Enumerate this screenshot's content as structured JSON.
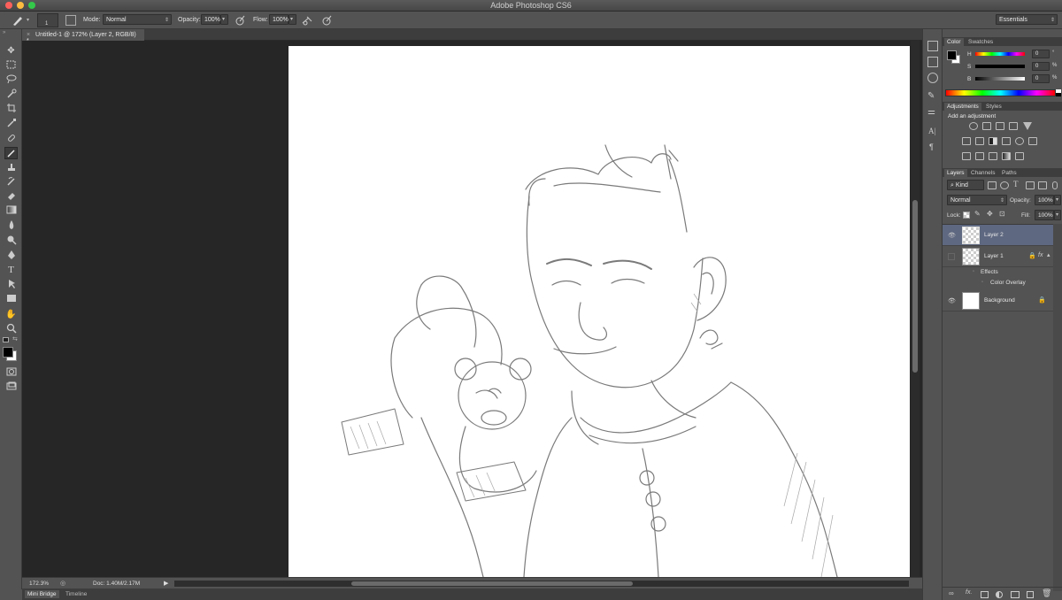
{
  "window": {
    "title": "Adobe Photoshop CS6",
    "traffic": [
      "#fc605c",
      "#fdbc40",
      "#34c84a"
    ]
  },
  "options": {
    "brush_size": "1",
    "mode_label": "Mode:",
    "mode_value": "Normal",
    "opacity_label": "Opacity:",
    "opacity_value": "100%",
    "flow_label": "Flow:",
    "flow_value": "100%",
    "workspace": "Essentials"
  },
  "document": {
    "tab_title": "Untitled-1 @ 172% (Layer 2, RGB/8) *"
  },
  "status": {
    "zoom": "172.3%",
    "doc_info": "Doc: 1.40M/2.17M"
  },
  "bottom_tabs": [
    "Mini Bridge",
    "Timeline"
  ],
  "color_panel": {
    "tabs": [
      "Color",
      "Swatches"
    ],
    "sliders": [
      {
        "label": "H",
        "value": "0",
        "unit": "°"
      },
      {
        "label": "S",
        "value": "0",
        "unit": "%"
      },
      {
        "label": "B",
        "value": "0",
        "unit": "%"
      }
    ]
  },
  "adjustments_panel": {
    "tabs": [
      "Adjustments",
      "Styles"
    ],
    "heading": "Add an adjustment"
  },
  "layers_panel": {
    "tabs": [
      "Layers",
      "Channels",
      "Paths"
    ],
    "filter_kind": "Kind",
    "blend_mode": "Normal",
    "opacity_label": "Opacity:",
    "opacity_value": "100%",
    "lock_label": "Lock:",
    "fill_label": "Fill:",
    "fill_value": "100%",
    "layers": [
      {
        "name": "Layer 2",
        "selected": true
      },
      {
        "name": "Layer 1",
        "selected": false,
        "fx": "fx"
      },
      {
        "name": "Background",
        "selected": false
      }
    ],
    "effects_label": "Effects",
    "effect_item": "Color Overlay"
  },
  "colors": {
    "panel_bg": "#535353",
    "dark_bg": "#262626",
    "selection": "#5e6880",
    "canvas": "#ffffff"
  }
}
